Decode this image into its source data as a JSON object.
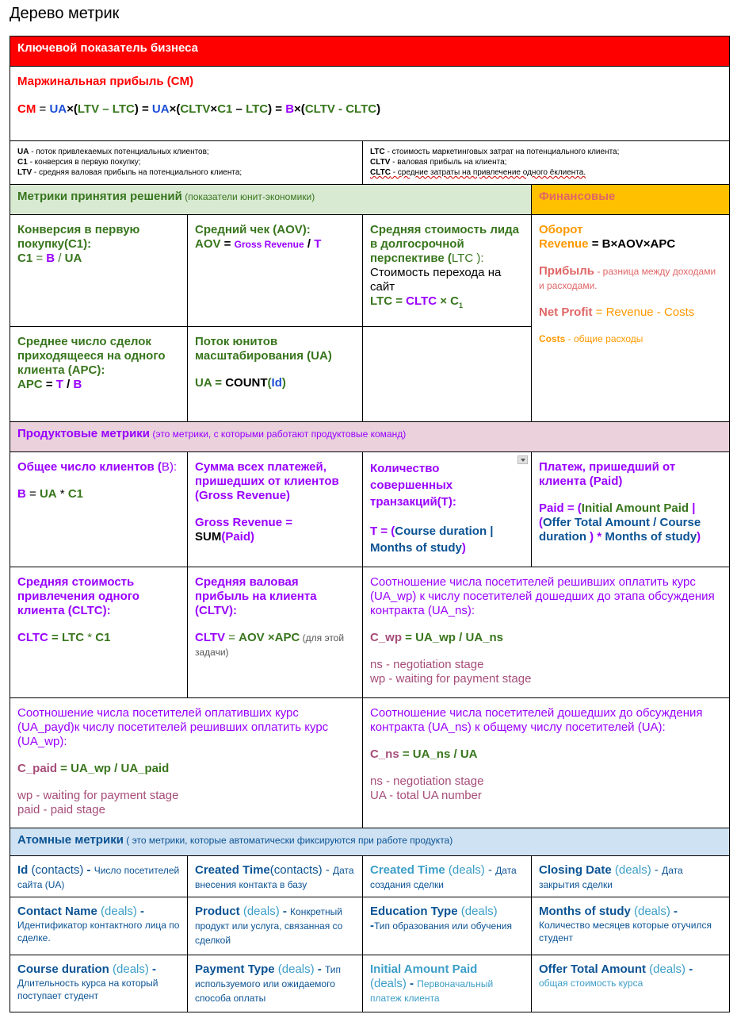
{
  "title": "Дерево метрик",
  "key": {
    "header": "Ключевой показатель бизнеса",
    "cm_title": "Маржинальная прибыль (CM)",
    "f": [
      "CM",
      " = ",
      "UA",
      "×(",
      "LTV – LTC",
      ")  = ",
      "UA",
      "×(",
      "CLTV",
      "×",
      "C1",
      " – ",
      "LTC",
      ") = ",
      "B",
      "×(",
      "CLTV - CLTC",
      ")"
    ],
    "legend_left": [
      {
        "k": "UA",
        "t": " - поток привлекаемых потенциальных клиентов;"
      },
      {
        "k": "C1",
        "t": " - конверсия в первую покупку;"
      },
      {
        "k": "LTV",
        "t": " - средняя валовая прибыль на потенциального клиента;"
      }
    ],
    "legend_right": [
      {
        "k": "LTC",
        "t": " - стоимость маркетинговых затрат на потенциального клиента;"
      },
      {
        "k": "CLTV",
        "t": " - валовая прибыль на клиента;"
      },
      {
        "k": "CLTC",
        "t": " - средние затраты на привлечение одного ёклиента."
      }
    ]
  },
  "decision": {
    "header": "Метрики принятия решений",
    "header_sub": " (показатели юнит-экономики)",
    "fin_header": "Финансовые",
    "c1": {
      "t": "Конверсия в первую покупку(C1):",
      "f": [
        " C1",
        " = ",
        "B",
        " / ",
        "UA"
      ]
    },
    "aov": {
      "t": "Средний чек (AOV):",
      "f": [
        "AOV",
        " = ",
        "Gross Revenue",
        " / ",
        "T"
      ]
    },
    "ltc": {
      "t1": "Средняя стоимость лида в долгосрочной перспективе (",
      "t2": "LTC",
      "t3": " ):",
      "d": "Стоимость перехода на сайт",
      "f": [
        "LTC",
        " = ",
        "CLTC",
        " × ",
        "C",
        "1"
      ]
    },
    "apc": {
      "t": "Среднее число сделок приходящееся на одного клиента (APC):",
      "f": [
        "APC",
        " = ",
        "T",
        " / ",
        "B"
      ]
    },
    "ua": {
      "t": "Поток юнитов масштабирования (UA)",
      "f": [
        "UA",
        " = ",
        "COUNT",
        "(",
        "Id",
        ")"
      ]
    },
    "fin": {
      "rev_t": "Оборот",
      "rev_f": [
        "Revenue",
        " = ",
        "B×AOV×APC"
      ],
      "profit_t": "Прибыль",
      "profit_d": " - разница между доходами и расходами.",
      "np": [
        "Net Profit",
        " = Revenue - Costs"
      ],
      "costs": [
        "Costs",
        " - общие расходы"
      ]
    }
  },
  "product": {
    "header": "Продуктовые метрики",
    "header_sub": " (это метрики, с которыми работают продуктовые команд)",
    "b": {
      "t1": "Общее число клиентов (",
      "t2": "B",
      "t3": "):",
      "f": [
        "B",
        " = ",
        "UA",
        " *  ",
        "C1"
      ]
    },
    "gr": {
      "t": "Сумма всех платежей, пришедших от клиентов (Gross Revenue)",
      "f1": "Gross Revenue =",
      "f2": "SUM",
      "f3": "(Paid)"
    },
    "t": {
      "t": "Количество совершенных транзакций(T):",
      "f": [
        "T = (",
        "Course duration | Months of study",
        ")"
      ]
    },
    "paid": {
      "t": "Платеж, пришедший от клиента (Paid)",
      "f": [
        "Paid",
        " = (",
        "Initial Amount Paid",
        " | (",
        "Offer Total Amount  / Course duration",
        " ) * ",
        "Months of study",
        ")"
      ]
    },
    "cltc": {
      "t": "Средняя стоимость привлечения одного клиента (CLTC):",
      "f": [
        "CLTC",
        " = ",
        "LTC",
        " * ",
        "C1"
      ]
    },
    "cltv": {
      "t": "Средняя валовая прибыль на клиента (CLTV):",
      "f": [
        "CLTV",
        " = ",
        "AOV",
        " ×",
        "APC"
      ],
      "note": " (для этой задачи)"
    },
    "cwp": {
      "t": "Соотношение числа посетителей решивших оплатить курс (UA_wp) к  числу посетителей дошедших до этапа обсуждения контракта (UA_ns):",
      "f": [
        "C_wp",
        " = ",
        "UA_wp",
        " / ",
        "UA_ns"
      ],
      "n1": "ns - negotiation stage",
      "n2": "wp - waiting for payment stage"
    },
    "cpaid": {
      "t": "Соотношение числа посетителей оплативших курс (UA_payd)к числу посетителей решивших оплатить курс (UA_wp):",
      "f": [
        "C_paid",
        " = ",
        "UA_wp",
        " / ",
        "UA_paid"
      ],
      "n1": "wp - waiting for payment stage",
      "n2": "paid - paid stage"
    },
    "cns": {
      "t": "Соотношение числа посетителей дошедших до обсуждения контракта (UA_ns) к общему числу посетителей (UA):",
      "f": [
        "C_ns",
        " = ",
        "UA_ns",
        " / ",
        "UA"
      ],
      "n1": "ns - negotiation stage",
      "n2": "UA - total UA number"
    }
  },
  "atomic": {
    "header": "Атомные метрики",
    "header_sub": " ( это метрики, которые автоматически фиксируются при работе продукта)",
    "rows": [
      [
        {
          "n": "Id",
          "s": " (contacts)",
          "dash": " - ",
          "d": "Число посетителей сайта (UA)"
        },
        {
          "n": "Created Time",
          "s": "(contacts)",
          "dash": " - ",
          "d": "Дата внесения контакта в базу"
        },
        {
          "n": "Created Time",
          "s": " (deals)",
          "dash": " - ",
          "d": "Дата создания сделки"
        },
        {
          "n": "Closing Date",
          "s": " (deals)",
          "dash": " - ",
          "d": "Дата закрытия сделки"
        }
      ],
      [
        {
          "n": "Contact Name",
          "s": " (deals)",
          "dash": " - ",
          "d": "Идентификатор контактного лица по сделке."
        },
        {
          "n": "Product",
          "s": " (deals)",
          "dash": " - ",
          "d": "Конкретный продукт или услуга, связанная со сделкой"
        },
        {
          "n": "Education Type",
          "s": " (deals)",
          "dash": " -",
          "d": "Тип образования или обучения"
        },
        {
          "n": "Months of study",
          "s": " (deals)",
          "dash": " - ",
          "d": "Количество месяцев которые отучился студент"
        }
      ],
      [
        {
          "n": "Course duration",
          "s": " (deals)",
          "dash": " - ",
          "d": "Длительность курса на который поступает студент"
        },
        {
          "n": "Payment Type",
          "s": " (deals)",
          "dash": " - ",
          "d": "Тип используемого или ожидаемого способа оплаты"
        },
        {
          "n": "Initial Amount Paid",
          "s": " (deals)",
          "dash": " - ",
          "d": "Первоначальный платеж клиента"
        },
        {
          "n": "Offer Total Amount",
          "s": " (deals)",
          "dash": " - ",
          "d": "общая стоимость курса"
        }
      ]
    ]
  }
}
